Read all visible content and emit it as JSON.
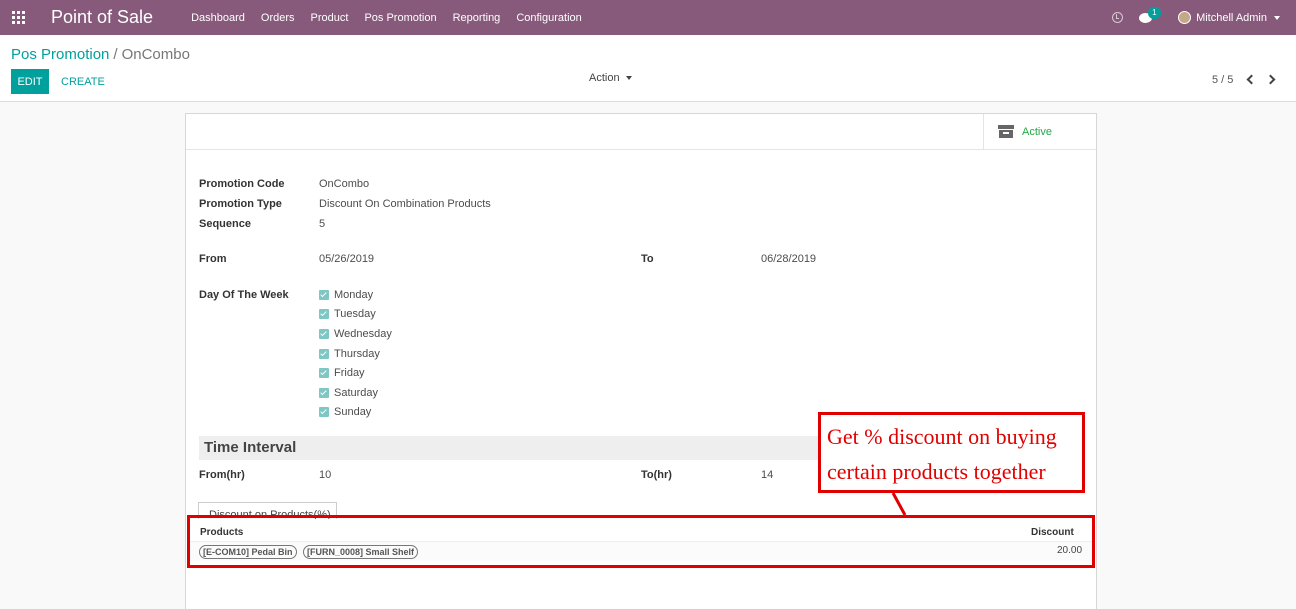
{
  "navbar": {
    "app_title": "Point of Sale",
    "menu": [
      "Dashboard",
      "Orders",
      "Product",
      "Pos Promotion",
      "Reporting",
      "Configuration"
    ],
    "chat_badge": "1",
    "user_name": "Mitchell Admin"
  },
  "control_panel": {
    "breadcrumb_parent": "Pos Promotion",
    "breadcrumb_separator": "/",
    "breadcrumb_current": "OnCombo",
    "edit_label": "EDIT",
    "create_label": "CREATE",
    "action_label": "Action",
    "pager": "5 / 5"
  },
  "form": {
    "active_label": "Active",
    "promotion_code_label": "Promotion Code",
    "promotion_code": "OnCombo",
    "promotion_type_label": "Promotion Type",
    "promotion_type": "Discount On Combination Products",
    "sequence_label": "Sequence",
    "sequence": "5",
    "from_label": "From",
    "from": "05/26/2019",
    "to_label": "To",
    "to": "06/28/2019",
    "day_of_week_label": "Day Of The Week",
    "days": [
      "Monday",
      "Tuesday",
      "Wednesday",
      "Thursday",
      "Friday",
      "Saturday",
      "Sunday"
    ],
    "time_interval_title": "Time Interval",
    "from_hr_label": "From(hr)",
    "from_hr": "10",
    "to_hr_label": "To(hr)",
    "to_hr": "14",
    "tab_label": "Discount on Products(%)",
    "table_header_products": "Products",
    "table_header_discount": "Discount",
    "product_tags": [
      "[E-COM10] Pedal Bin",
      "[FURN_0008] Small Shelf"
    ],
    "discount_value": "20.00"
  },
  "annotation": {
    "line1": "Get % discount on buying",
    "line2": "certain products together",
    "color": "#e00000"
  },
  "colors": {
    "navbar": "#875a7b",
    "accent": "#00a09d",
    "active": "#28a745"
  }
}
